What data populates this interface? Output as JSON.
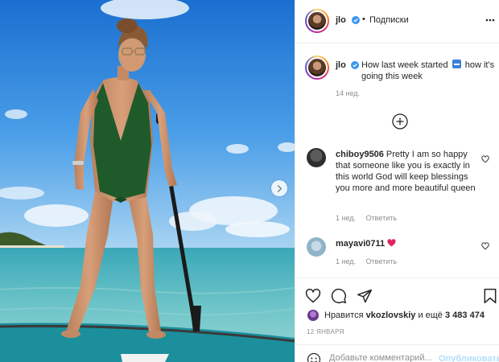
{
  "post": {
    "username": "jlo",
    "follow_status": "Подписки",
    "dot": "•",
    "caption": {
      "username": "jlo",
      "text_before": "How last week started",
      "text_after": "how it's going this week",
      "time": "14 нед."
    }
  },
  "comments": [
    {
      "username": "chiboy9506",
      "text": "Pretty I am so happy that someone like you is exactly in this world God will keep blessings you more and more beautiful queen",
      "time": "1 нед.",
      "reply_label": "Ответить"
    },
    {
      "username": "mayavi0711",
      "text": "",
      "time": "1 нед.",
      "reply_label": "Ответить"
    }
  ],
  "likes": {
    "prefix": "Нравится",
    "liker": "vkozlovskiy",
    "conjunction": "и ещё",
    "count": "3 483 474"
  },
  "post_date": "12 ЯНВАРЯ",
  "add_comment": {
    "placeholder": "Добавьте комментарий...",
    "post_label": "Опубликовать"
  },
  "icons": {
    "verified": "verified-badge-icon",
    "more": "more-options-icon",
    "load_more": "plus-circle-icon",
    "like": "heart-outline-icon",
    "comment": "speech-bubble-icon",
    "share": "paper-plane-icon",
    "save": "bookmark-icon",
    "emoji": "smiley-icon",
    "next": "chevron-right-icon"
  },
  "colors": {
    "accent": "#0095f6",
    "verified": "#3897f0",
    "muted": "#8e8e8e",
    "post_disabled": "#b2dffc",
    "heart_emoji": "#e0245e"
  }
}
